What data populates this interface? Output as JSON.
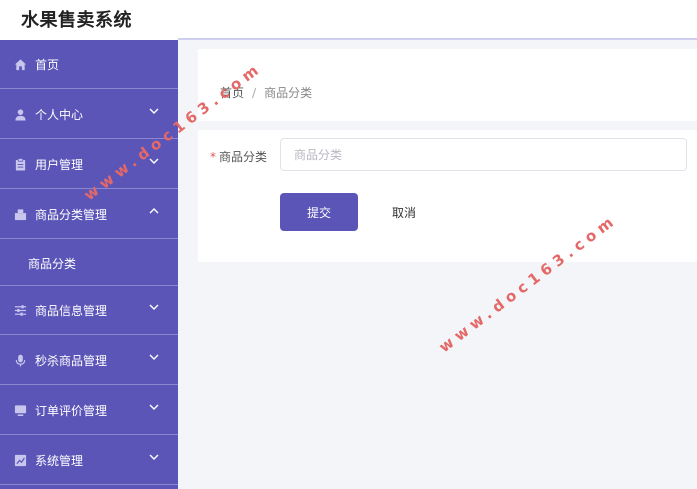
{
  "app": {
    "title": "水果售卖系统"
  },
  "sidebar": {
    "items": [
      {
        "label": "首页",
        "icon": "home-icon",
        "expandable": false
      },
      {
        "label": "个人中心",
        "icon": "user-icon",
        "expandable": true
      },
      {
        "label": "用户管理",
        "icon": "clipboard-icon",
        "expandable": true
      },
      {
        "label": "商品分类管理",
        "icon": "box-icon",
        "expandable": true,
        "expanded": true
      },
      {
        "label": "商品信息管理",
        "icon": "sliders-icon",
        "expandable": true
      },
      {
        "label": "秒杀商品管理",
        "icon": "microphone-icon",
        "expandable": true
      },
      {
        "label": "订单评价管理",
        "icon": "monitor-icon",
        "expandable": true
      },
      {
        "label": "系统管理",
        "icon": "chart-icon",
        "expandable": true
      }
    ],
    "subitems": [
      {
        "label": "商品分类",
        "parent": "商品分类管理"
      }
    ]
  },
  "breadcrumb": {
    "home": "首页",
    "separator": "/",
    "current": "商品分类"
  },
  "form": {
    "field_label": "商品分类",
    "required_mark": "*",
    "placeholder": "商品分类",
    "value": "",
    "submit_label": "提交",
    "cancel_label": "取消"
  },
  "watermark": {
    "text": "www.doc163.com"
  },
  "colors": {
    "accent": "#5b55b8",
    "sidebar_bg": "#5b55b8",
    "main_bg": "#f4f5f8",
    "watermark": "#e46868",
    "required": "#e05a5a"
  }
}
